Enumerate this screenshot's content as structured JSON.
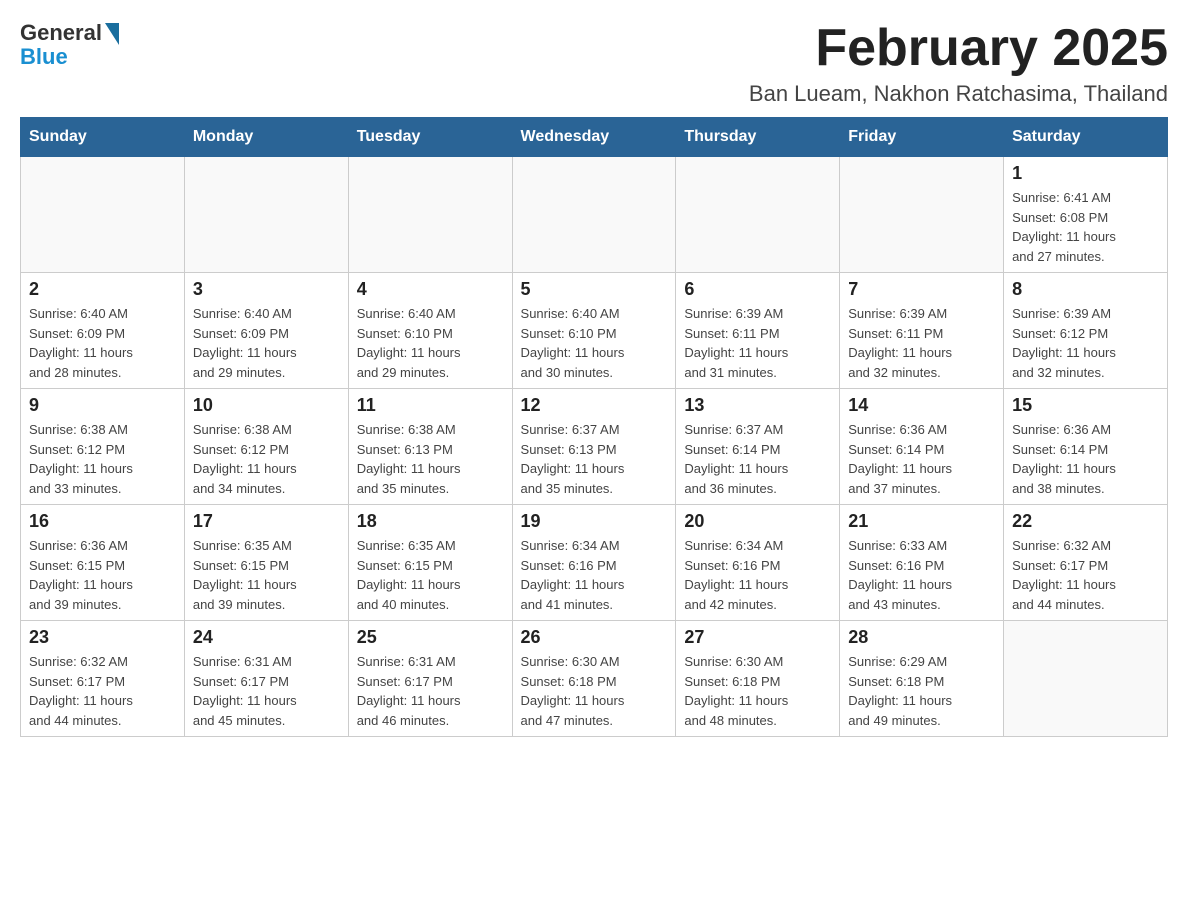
{
  "header": {
    "logo": {
      "general_text": "General",
      "blue_text": "Blue"
    },
    "title": "February 2025",
    "subtitle": "Ban Lueam, Nakhon Ratchasima, Thailand"
  },
  "days_of_week": [
    "Sunday",
    "Monday",
    "Tuesday",
    "Wednesday",
    "Thursday",
    "Friday",
    "Saturday"
  ],
  "weeks": [
    [
      {
        "day": "",
        "info": ""
      },
      {
        "day": "",
        "info": ""
      },
      {
        "day": "",
        "info": ""
      },
      {
        "day": "",
        "info": ""
      },
      {
        "day": "",
        "info": ""
      },
      {
        "day": "",
        "info": ""
      },
      {
        "day": "1",
        "info": "Sunrise: 6:41 AM\nSunset: 6:08 PM\nDaylight: 11 hours\nand 27 minutes."
      }
    ],
    [
      {
        "day": "2",
        "info": "Sunrise: 6:40 AM\nSunset: 6:09 PM\nDaylight: 11 hours\nand 28 minutes."
      },
      {
        "day": "3",
        "info": "Sunrise: 6:40 AM\nSunset: 6:09 PM\nDaylight: 11 hours\nand 29 minutes."
      },
      {
        "day": "4",
        "info": "Sunrise: 6:40 AM\nSunset: 6:10 PM\nDaylight: 11 hours\nand 29 minutes."
      },
      {
        "day": "5",
        "info": "Sunrise: 6:40 AM\nSunset: 6:10 PM\nDaylight: 11 hours\nand 30 minutes."
      },
      {
        "day": "6",
        "info": "Sunrise: 6:39 AM\nSunset: 6:11 PM\nDaylight: 11 hours\nand 31 minutes."
      },
      {
        "day": "7",
        "info": "Sunrise: 6:39 AM\nSunset: 6:11 PM\nDaylight: 11 hours\nand 32 minutes."
      },
      {
        "day": "8",
        "info": "Sunrise: 6:39 AM\nSunset: 6:12 PM\nDaylight: 11 hours\nand 32 minutes."
      }
    ],
    [
      {
        "day": "9",
        "info": "Sunrise: 6:38 AM\nSunset: 6:12 PM\nDaylight: 11 hours\nand 33 minutes."
      },
      {
        "day": "10",
        "info": "Sunrise: 6:38 AM\nSunset: 6:12 PM\nDaylight: 11 hours\nand 34 minutes."
      },
      {
        "day": "11",
        "info": "Sunrise: 6:38 AM\nSunset: 6:13 PM\nDaylight: 11 hours\nand 35 minutes."
      },
      {
        "day": "12",
        "info": "Sunrise: 6:37 AM\nSunset: 6:13 PM\nDaylight: 11 hours\nand 35 minutes."
      },
      {
        "day": "13",
        "info": "Sunrise: 6:37 AM\nSunset: 6:14 PM\nDaylight: 11 hours\nand 36 minutes."
      },
      {
        "day": "14",
        "info": "Sunrise: 6:36 AM\nSunset: 6:14 PM\nDaylight: 11 hours\nand 37 minutes."
      },
      {
        "day": "15",
        "info": "Sunrise: 6:36 AM\nSunset: 6:14 PM\nDaylight: 11 hours\nand 38 minutes."
      }
    ],
    [
      {
        "day": "16",
        "info": "Sunrise: 6:36 AM\nSunset: 6:15 PM\nDaylight: 11 hours\nand 39 minutes."
      },
      {
        "day": "17",
        "info": "Sunrise: 6:35 AM\nSunset: 6:15 PM\nDaylight: 11 hours\nand 39 minutes."
      },
      {
        "day": "18",
        "info": "Sunrise: 6:35 AM\nSunset: 6:15 PM\nDaylight: 11 hours\nand 40 minutes."
      },
      {
        "day": "19",
        "info": "Sunrise: 6:34 AM\nSunset: 6:16 PM\nDaylight: 11 hours\nand 41 minutes."
      },
      {
        "day": "20",
        "info": "Sunrise: 6:34 AM\nSunset: 6:16 PM\nDaylight: 11 hours\nand 42 minutes."
      },
      {
        "day": "21",
        "info": "Sunrise: 6:33 AM\nSunset: 6:16 PM\nDaylight: 11 hours\nand 43 minutes."
      },
      {
        "day": "22",
        "info": "Sunrise: 6:32 AM\nSunset: 6:17 PM\nDaylight: 11 hours\nand 44 minutes."
      }
    ],
    [
      {
        "day": "23",
        "info": "Sunrise: 6:32 AM\nSunset: 6:17 PM\nDaylight: 11 hours\nand 44 minutes."
      },
      {
        "day": "24",
        "info": "Sunrise: 6:31 AM\nSunset: 6:17 PM\nDaylight: 11 hours\nand 45 minutes."
      },
      {
        "day": "25",
        "info": "Sunrise: 6:31 AM\nSunset: 6:17 PM\nDaylight: 11 hours\nand 46 minutes."
      },
      {
        "day": "26",
        "info": "Sunrise: 6:30 AM\nSunset: 6:18 PM\nDaylight: 11 hours\nand 47 minutes."
      },
      {
        "day": "27",
        "info": "Sunrise: 6:30 AM\nSunset: 6:18 PM\nDaylight: 11 hours\nand 48 minutes."
      },
      {
        "day": "28",
        "info": "Sunrise: 6:29 AM\nSunset: 6:18 PM\nDaylight: 11 hours\nand 49 minutes."
      },
      {
        "day": "",
        "info": ""
      }
    ]
  ]
}
